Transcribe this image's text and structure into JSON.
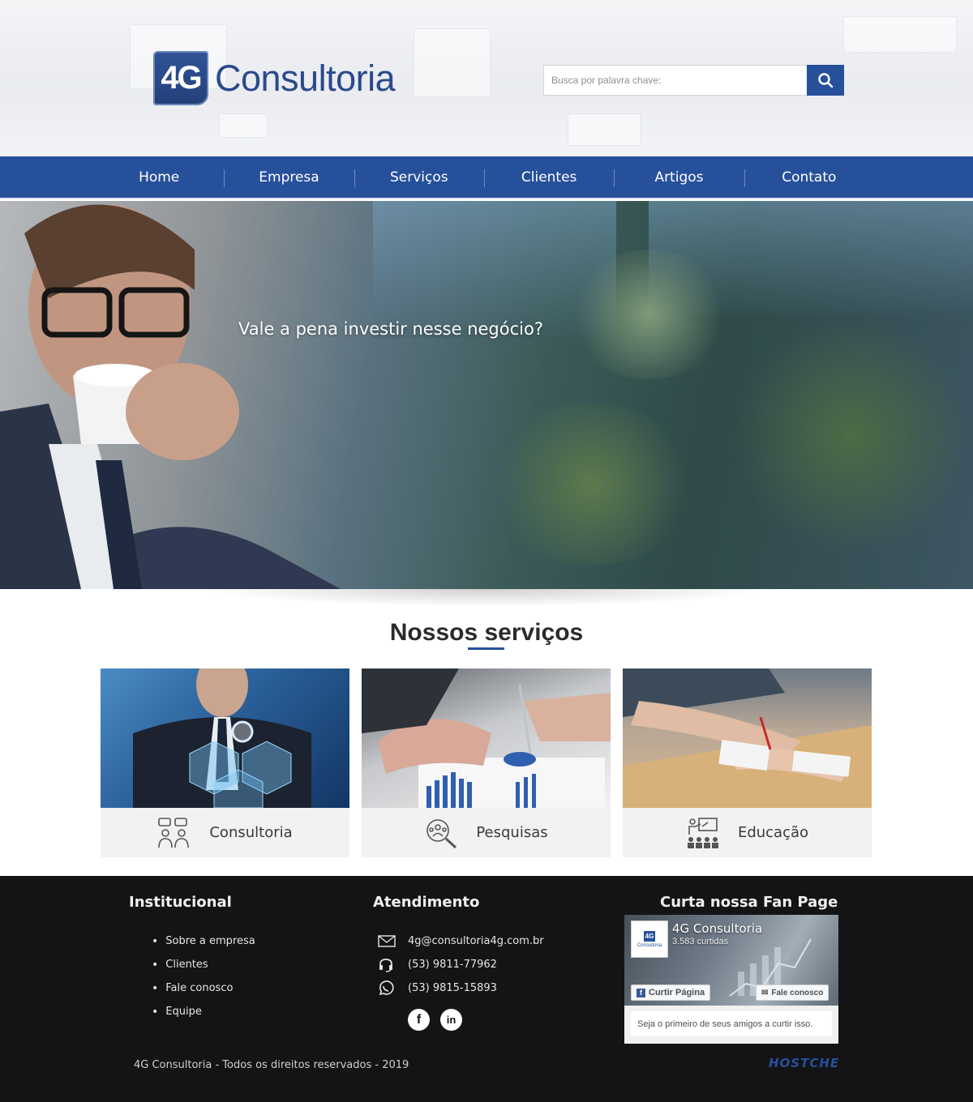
{
  "header": {
    "logo_mark": "4G",
    "logo_text": "Consultoria",
    "search_placeholder": "Busca por palavra chave:",
    "search_icon": "search-icon"
  },
  "nav": {
    "items": [
      {
        "label": "Home"
      },
      {
        "label": "Empresa"
      },
      {
        "label": "Serviços"
      },
      {
        "label": "Clientes"
      },
      {
        "label": "Artigos"
      },
      {
        "label": "Contato"
      }
    ]
  },
  "hero": {
    "caption": "Vale a pena investir nesse negócio?"
  },
  "services": {
    "title": "Nossos serviços",
    "cards": [
      {
        "label": "Consultoria",
        "icon": "consulting-people-icon"
      },
      {
        "label": "Pesquisas",
        "icon": "research-magnifier-icon"
      },
      {
        "label": "Educação",
        "icon": "classroom-icon"
      }
    ]
  },
  "footer": {
    "institucional": {
      "title": "Institucional",
      "links": [
        "Sobre a empresa",
        "Clientes",
        "Fale conosco",
        "Equipe"
      ]
    },
    "atendimento": {
      "title": "Atendimento",
      "email": "4g@consultoria4g.com.br",
      "phone": "(53) 9811-77962",
      "whatsapp": "(53) 9815-15893",
      "socials": [
        "facebook-icon",
        "linkedin-icon"
      ]
    },
    "fanpage": {
      "title": "Curta nossa Fan Page",
      "page_name": "4G Consultoria",
      "likes": "3.583 curtidas",
      "like_button": "Curtir Página",
      "message_button": "Fale conosco",
      "friends_text": "Seja o primeiro de seus amigos a curtir isso.",
      "avatar_mark": "4G",
      "avatar_text": "Consultoria"
    },
    "copyright": "4G Consultoria - Todos os direitos reservados - 2019",
    "developer": "HOSTCHE"
  },
  "colors": {
    "brand_blue": "#27509b",
    "footer_bg": "#141416"
  }
}
